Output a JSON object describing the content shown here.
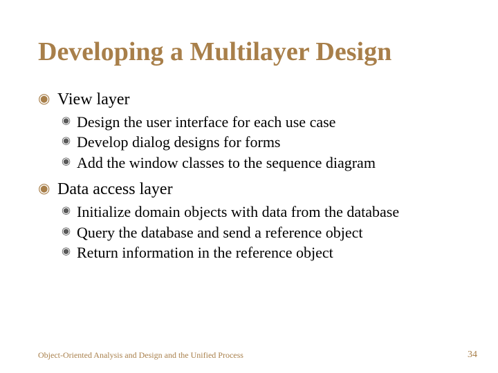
{
  "title": "Developing a Multilayer Design",
  "sections": [
    {
      "heading": "View layer",
      "items": [
        "Design the user interface for each use case",
        "Develop dialog designs for forms",
        "Add the window classes to the sequence diagram"
      ]
    },
    {
      "heading": "Data access layer",
      "items": [
        "Initialize domain objects with data from the database",
        "Query the database and send a reference object",
        "Return information in the reference object"
      ]
    }
  ],
  "footer": "Object-Oriented Analysis and Design and the Unified Process",
  "page_number": "34"
}
